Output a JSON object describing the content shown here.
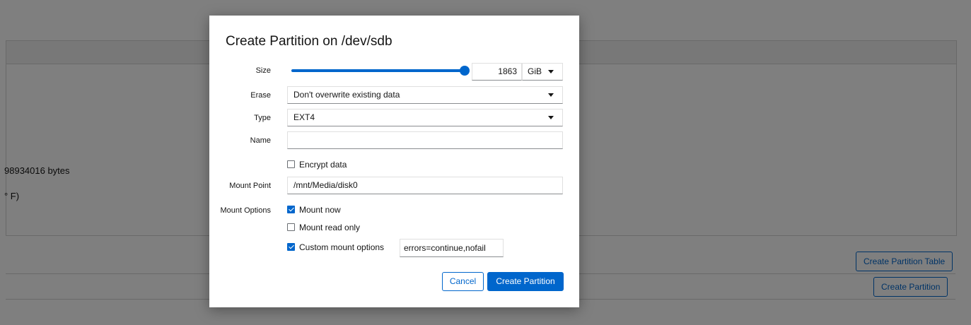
{
  "background": {
    "bytes_text": "98934016 bytes",
    "temp_text": "° F)",
    "create_partition_table_label": "Create Partition Table",
    "create_partition_label": "Create Partition"
  },
  "dialog": {
    "title": "Create Partition on /dev/sdb",
    "size": {
      "label": "Size",
      "value": "1863",
      "unit": "GiB",
      "slider_fraction": 1.0
    },
    "erase": {
      "label": "Erase",
      "value": "Don't overwrite existing data"
    },
    "type": {
      "label": "Type",
      "value": "EXT4"
    },
    "name": {
      "label": "Name",
      "value": ""
    },
    "encrypt": {
      "label": "Encrypt data",
      "checked": false
    },
    "mount_point": {
      "label": "Mount Point",
      "value": "/mnt/Media/disk0"
    },
    "mount_options": {
      "label": "Mount Options",
      "mount_now": {
        "label": "Mount now",
        "checked": true
      },
      "read_only": {
        "label": "Mount read only",
        "checked": false
      },
      "custom": {
        "label": "Custom mount options",
        "checked": true,
        "value": "errors=continue,nofail"
      }
    },
    "buttons": {
      "cancel": "Cancel",
      "create": "Create Partition"
    }
  },
  "colors": {
    "accent": "#0066cc",
    "overlay": "rgba(0,0,0,0.5)"
  }
}
